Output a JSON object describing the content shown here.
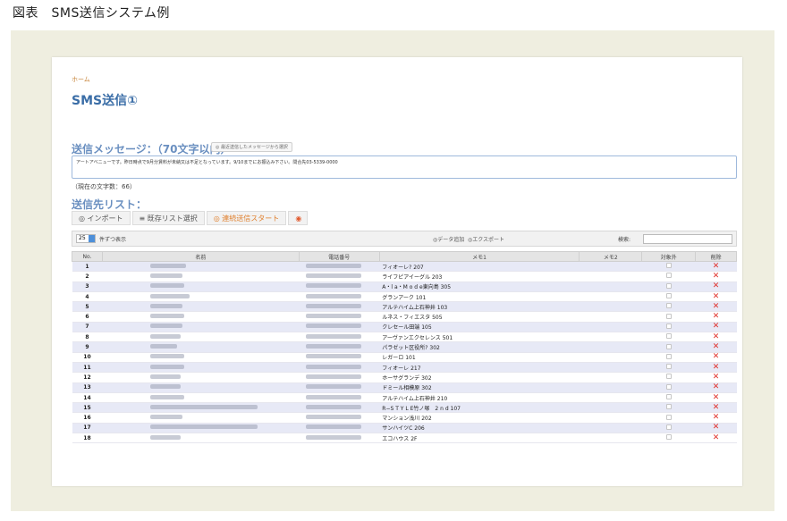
{
  "caption": "図表　SMS送信システム例",
  "breadcrumb": "ホーム",
  "page_title": "SMS送信①",
  "message": {
    "label": "送信メッセージ：（70文字以内）",
    "recent_button": "◎ 最近送信したメッセージから選択",
    "text": "アートアベニューです。昨日時点で9月分賃料が未納又は不足となっています。9/10までにお振込み下さい。問合先03-5339-0000",
    "char_count": "（現在の文字数：66）"
  },
  "recipients": {
    "label": "送信先リスト：",
    "tabs": [
      {
        "label": "◎ インポート"
      },
      {
        "label": "≡ 既存リスト選択"
      },
      {
        "label": "◎ 連続送信スタート"
      },
      {
        "label": "◉"
      }
    ]
  },
  "toolbar": {
    "per_page_value": "25",
    "per_page_suffix": "件ずつ表示",
    "add_data": "◎データ追加",
    "export": "◎エクスポート",
    "search_label": "検索:"
  },
  "table": {
    "headers": [
      "No.",
      "名前",
      "電話番号",
      "メモ1",
      "メモ2",
      "対象外",
      "削除"
    ],
    "rows": [
      {
        "no": "1",
        "memo": "フィオーレ? 207"
      },
      {
        "no": "2",
        "memo": "ライフピアイーグル 203"
      },
      {
        "no": "3",
        "memo": "A・l a・M o d e東向島 305"
      },
      {
        "no": "4",
        "memo": "グランアーク 101"
      },
      {
        "no": "5",
        "memo": "アルテハイム上石神井 103"
      },
      {
        "no": "6",
        "memo": "ルネス・フィエスタ 505"
      },
      {
        "no": "7",
        "memo": "クレセール田端 105"
      },
      {
        "no": "8",
        "memo": "アーヴァンエクセレンス 501"
      },
      {
        "no": "9",
        "memo": "パラゼット区役所? 302"
      },
      {
        "no": "10",
        "memo": "レガーロ 101"
      },
      {
        "no": "11",
        "memo": "フィオーレ 217"
      },
      {
        "no": "12",
        "memo": "ホーサグランデ 302"
      },
      {
        "no": "13",
        "memo": "ドミール相模原 302"
      },
      {
        "no": "14",
        "memo": "アルテハイム上石神井 210"
      },
      {
        "no": "15",
        "memo": "R−S T Y L E竹ノ塚　2 n d 107"
      },
      {
        "no": "16",
        "memo": "マンション浅川 202"
      },
      {
        "no": "17",
        "memo": "サンハイツC 206"
      },
      {
        "no": "18",
        "memo": "エコハウス 2F"
      }
    ]
  },
  "colors": {
    "accent_blue": "#3b6ea7",
    "delete_red": "#e0302a",
    "row_stripe": "#e7e9f6",
    "frame_bg": "#efeee0"
  }
}
